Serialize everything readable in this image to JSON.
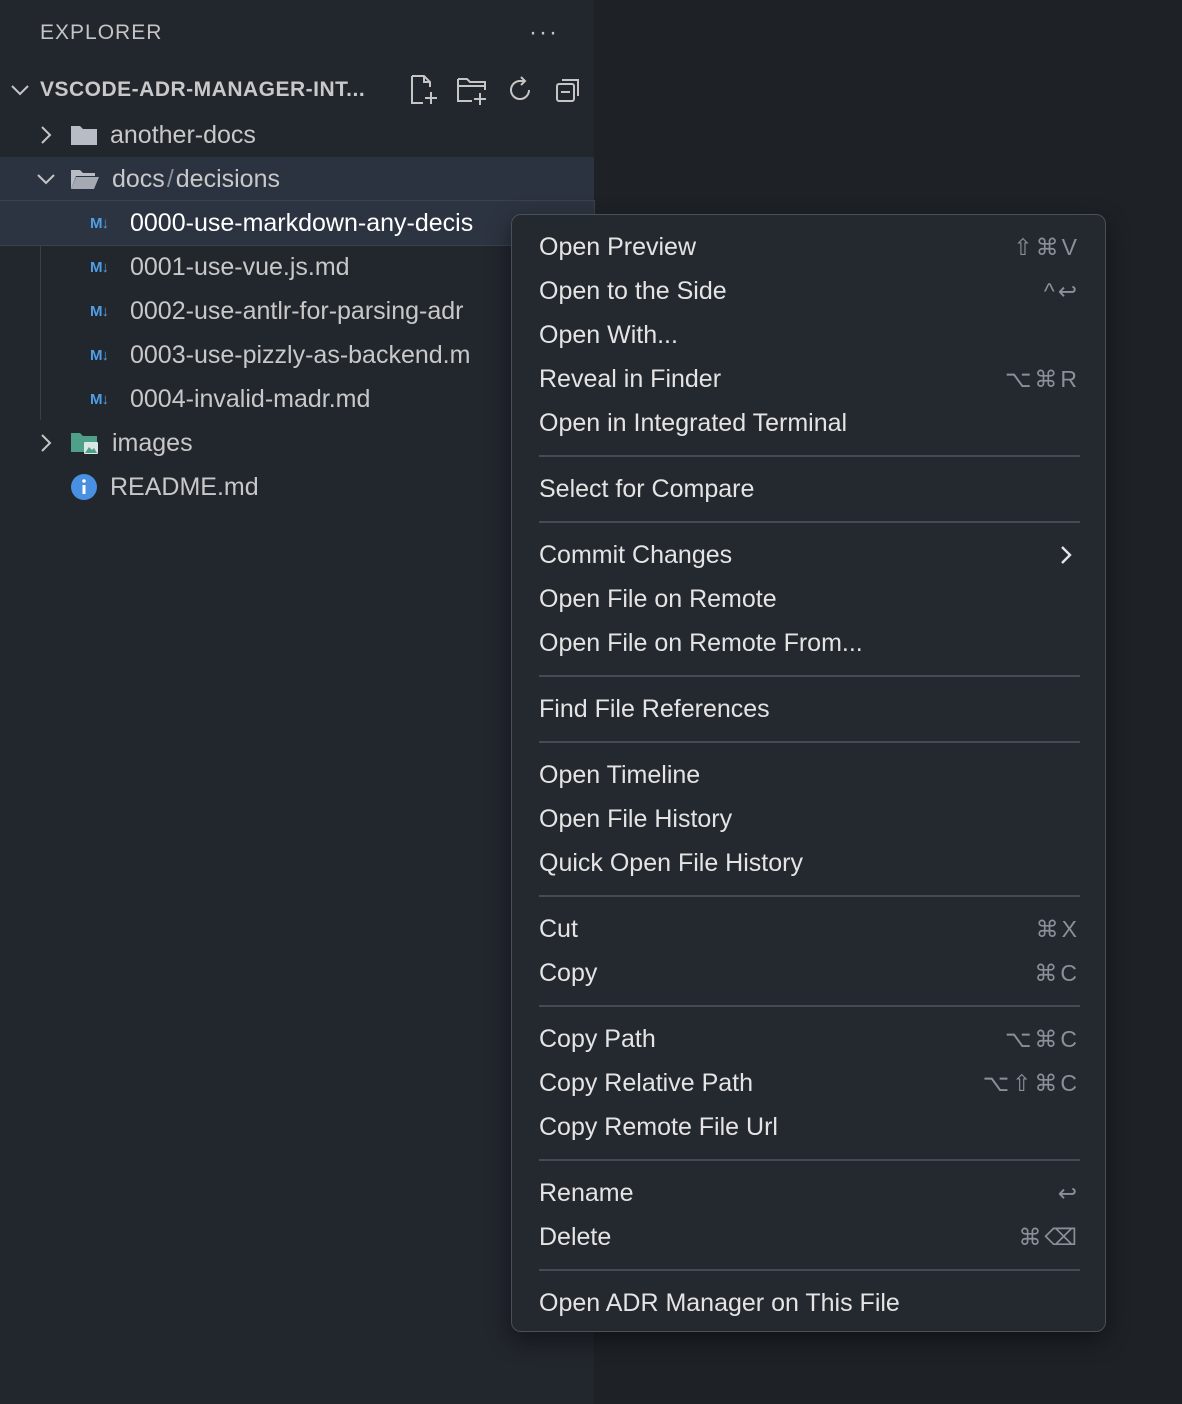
{
  "explorer": {
    "title": "EXPLORER",
    "more_label": "···",
    "root_label": "VSCODE-ADR-MANAGER-INT...",
    "root_actions": [
      "new-file-icon",
      "new-folder-icon",
      "refresh-icon",
      "collapse-all-icon"
    ]
  },
  "tree": {
    "another_docs": "another-docs",
    "docs_part": "docs",
    "slash": "/",
    "decisions_part": "decisions",
    "md_badge": "M↓",
    "files": [
      "0000-use-markdown-any-decis",
      "0001-use-vue.js.md",
      "0002-use-antlr-for-parsing-adr",
      "0003-use-pizzly-as-backend.m",
      "0004-invalid-madr.md"
    ],
    "images": "images",
    "readme": "README.md"
  },
  "menu": {
    "groups": [
      [
        {
          "label": "Open Preview",
          "shortcut": "⇧⌘V"
        },
        {
          "label": "Open to the Side",
          "shortcut": "^↩"
        },
        {
          "label": "Open With...",
          "shortcut": ""
        },
        {
          "label": "Reveal in Finder",
          "shortcut": "⌥⌘R"
        },
        {
          "label": "Open in Integrated Terminal",
          "shortcut": ""
        }
      ],
      [
        {
          "label": "Select for Compare",
          "shortcut": ""
        }
      ],
      [
        {
          "label": "Commit Changes",
          "shortcut": ""
        },
        {
          "label": "Open File on Remote",
          "shortcut": ""
        },
        {
          "label": "Open File on Remote From...",
          "shortcut": ""
        }
      ],
      [
        {
          "label": "Find File References",
          "shortcut": ""
        }
      ],
      [
        {
          "label": "Open Timeline",
          "shortcut": ""
        },
        {
          "label": "Open File History",
          "shortcut": ""
        },
        {
          "label": "Quick Open File History",
          "shortcut": ""
        }
      ],
      [
        {
          "label": "Cut",
          "shortcut": "⌘X"
        },
        {
          "label": "Copy",
          "shortcut": "⌘C"
        }
      ],
      [
        {
          "label": "Copy Path",
          "shortcut": "⌥⌘C"
        },
        {
          "label": "Copy Relative Path",
          "shortcut": "⌥⇧⌘C"
        },
        {
          "label": "Copy Remote File Url",
          "shortcut": ""
        }
      ],
      [
        {
          "label": "Rename",
          "shortcut": "↩"
        },
        {
          "label": "Delete",
          "shortcut": "⌘⌫"
        }
      ],
      [
        {
          "label": "Open ADR Manager on This File",
          "shortcut": ""
        }
      ]
    ]
  },
  "colors": {
    "sidebar_bg": "#22262d",
    "menu_bg": "#24282f",
    "markdown_icon": "#4f9fe6",
    "info_icon": "#4a90e2",
    "images_folder_icon": "#4fa088"
  }
}
